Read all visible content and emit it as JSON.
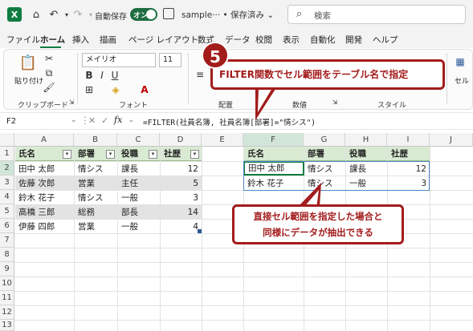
{
  "titlebar": {
    "autosave_label": "自動保存",
    "autosave_state": "オン",
    "doc_title": "sample··· • 保存済み ⌄",
    "search_placeholder": "検索"
  },
  "menu": {
    "tabs": [
      "ファイル",
      "ホーム",
      "挿入",
      "描画",
      "ページ レイアウト",
      "数式",
      "データ",
      "校閲",
      "表示",
      "自動化",
      "開発",
      "ヘルプ"
    ],
    "active": "ホーム"
  },
  "ribbon": {
    "paste_label": "貼り付け",
    "font_name": "メイリオ",
    "font_size": "11",
    "groups": [
      "クリップボード",
      "フォント",
      "配置",
      "数値",
      "スタイル"
    ],
    "cell_label": "セル"
  },
  "formula_bar": {
    "name_box": "F2",
    "fx": "fx",
    "formula": "=FILTER(社員名簿, 社員名簿[部署]=\"情シス\")"
  },
  "grid": {
    "columns": [
      "A",
      "B",
      "C",
      "D",
      "E",
      "F",
      "G",
      "H",
      "I",
      "J"
    ],
    "rows": [
      "1",
      "2",
      "3",
      "4",
      "5",
      "6",
      "7",
      "8",
      "9",
      "10",
      "11",
      "12",
      "13"
    ],
    "table1": {
      "headers": [
        "氏名",
        "部署",
        "役職",
        "社歴"
      ],
      "rows": [
        [
          "田中 太郎",
          "情シス",
          "課長",
          "12"
        ],
        [
          "佐藤 次郎",
          "営業",
          "主任",
          "5"
        ],
        [
          "鈴木 花子",
          "情シス",
          "一般",
          "3"
        ],
        [
          "高橋 三郎",
          "総務",
          "部長",
          "14"
        ],
        [
          "伊藤 四郎",
          "営業",
          "一般",
          "4"
        ]
      ]
    },
    "table2": {
      "headers": [
        "氏名",
        "部署",
        "役職",
        "社歴"
      ],
      "rows": [
        [
          "田中 太郎",
          "情シス",
          "課長",
          "12"
        ],
        [
          "鈴木 花子",
          "情シス",
          "一般",
          "3"
        ]
      ]
    }
  },
  "callouts": {
    "step": "5",
    "top": "FILTER関数でセル範囲をテーブル名で指定",
    "bottom_line1": "直接セル範囲を指定した場合と",
    "bottom_line2": "同様にデータが抽出できる"
  },
  "colors": {
    "accent": "#107c41",
    "callout": "#a31c1c",
    "header_fill": "#d9ead3"
  }
}
